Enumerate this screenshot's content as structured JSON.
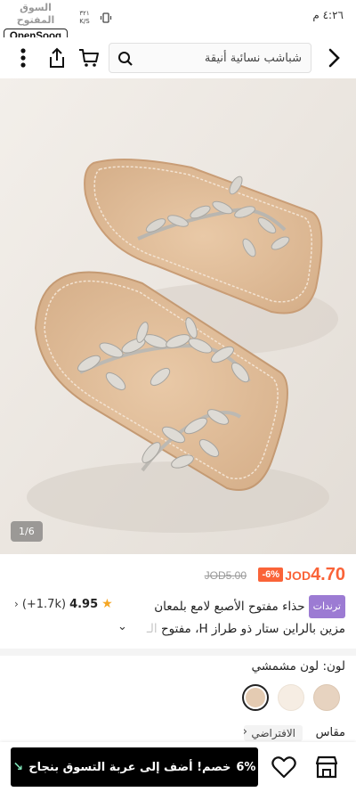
{
  "status_bar": {
    "time": "٤:٢٦ م",
    "watermark_ar": "السوق المفتوح",
    "watermark_logo": "OpenSooq",
    "net_speed": "٣٢١ K/S"
  },
  "search": {
    "text": "شباشب نسائية أنيقة"
  },
  "product": {
    "image_counter": "1/6",
    "price_current_prefix": "JOD",
    "price_current_value": "4.70",
    "discount": "-6%",
    "price_old": "JOD5.00",
    "trend_badge": "ترندات",
    "title_line1": "حذاء مفتوح الأصبع لامع بلمعان",
    "title_line2": "مزين بالراين ستار ذو طراز H، مفتوح",
    "title_line2_faded": " الـ",
    "rating_score": "4.95",
    "rating_count": "(+1.7k)"
  },
  "color": {
    "label": "لون: لون مشمشي",
    "swatches": [
      "#e4cbb2",
      "#f6ede3",
      "#e7d3c0"
    ]
  },
  "size": {
    "label": "مقاس",
    "default": "الافتراضي"
  },
  "bottom_bar": {
    "discount_pct": "6%",
    "add_cart_text": "خصم! أضف إلى عربة التسوق بنجاح"
  },
  "colors": {
    "accent": "#fa6338",
    "trend": "#9c7bd3",
    "button": "#000000"
  }
}
